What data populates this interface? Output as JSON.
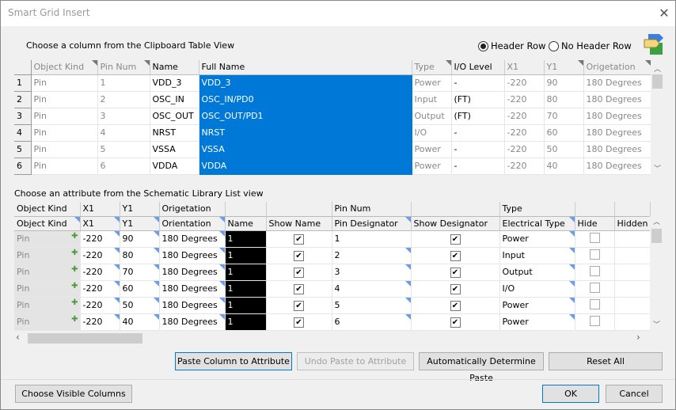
{
  "window": {
    "title": "Smart Grid Insert",
    "close_label": "✕"
  },
  "clipboard": {
    "label": "Choose a column from the Clipboard Table View",
    "header_row_label": "Header Row",
    "no_header_row_label": "No Header Row",
    "header_row_selected": true,
    "columns": [
      "Object Kind",
      "Pin Num",
      "Name",
      "Full Name",
      "Type",
      "I/O Level",
      "X1",
      "Y1",
      "Origetation"
    ],
    "selected_column": "Full Name",
    "rows": [
      [
        "1",
        "Pin",
        "1",
        "VDD_3",
        "VDD_3",
        "Power",
        "-",
        "-220",
        "90",
        "180 Degrees"
      ],
      [
        "2",
        "Pin",
        "2",
        "OSC_IN",
        "OSC_IN/PD0",
        "Input",
        "(FT)",
        "-220",
        "80",
        "180 Degrees"
      ],
      [
        "3",
        "Pin",
        "3",
        "OSC_OUT",
        "OSC_OUT/PD1",
        "Output",
        "(FT)",
        "-220",
        "70",
        "180 Degrees"
      ],
      [
        "4",
        "Pin",
        "4",
        "NRST",
        "NRST",
        "I/O",
        "-",
        "-220",
        "60",
        "180 Degrees"
      ],
      [
        "5",
        "Pin",
        "5",
        "VSSA",
        "VSSA",
        "Power",
        "-",
        "-220",
        "50",
        "180 Degrees"
      ],
      [
        "6",
        "Pin",
        "6",
        "VDDA",
        "VDDA",
        "Power",
        "-",
        "-220",
        "40",
        "180 Degrees"
      ]
    ]
  },
  "schematic": {
    "label": "Choose an attribute from the Schematic Library List view",
    "mapped_headers": [
      "Object Kind",
      "X1",
      "Y1",
      "Origetation",
      "",
      "",
      "Pin Num",
      "",
      "Type",
      "",
      ""
    ],
    "columns": [
      "Object Kind",
      "X1",
      "Y1",
      "Orientation",
      "Name",
      "Show Name",
      "Pin Designator",
      "Show Designator",
      "Electrical Type",
      "Hide",
      "Hidden"
    ],
    "rows": [
      {
        "kind": "Pin",
        "x1": "-220",
        "y1": "90",
        "orientation": "180 Degrees",
        "name": "1",
        "show_name": true,
        "designator": "1",
        "show_designator": true,
        "type": "Power",
        "hide": false
      },
      {
        "kind": "Pin",
        "x1": "-220",
        "y1": "80",
        "orientation": "180 Degrees",
        "name": "1",
        "show_name": true,
        "designator": "2",
        "show_designator": true,
        "type": "Input",
        "hide": false
      },
      {
        "kind": "Pin",
        "x1": "-220",
        "y1": "70",
        "orientation": "180 Degrees",
        "name": "1",
        "show_name": true,
        "designator": "3",
        "show_designator": true,
        "type": "Output",
        "hide": false
      },
      {
        "kind": "Pin",
        "x1": "-220",
        "y1": "60",
        "orientation": "180 Degrees",
        "name": "1",
        "show_name": true,
        "designator": "4",
        "show_designator": true,
        "type": "I/O",
        "hide": false
      },
      {
        "kind": "Pin",
        "x1": "-220",
        "y1": "50",
        "orientation": "180 Degrees",
        "name": "1",
        "show_name": true,
        "designator": "5",
        "show_designator": true,
        "type": "Power",
        "hide": false
      },
      {
        "kind": "Pin",
        "x1": "-220",
        "y1": "40",
        "orientation": "180 Degrees",
        "name": "1",
        "show_name": true,
        "designator": "6",
        "show_designator": true,
        "type": "Power",
        "hide": false
      }
    ]
  },
  "buttons": {
    "paste": "Paste Column to Attribute",
    "undo": "Undo Paste to Attribute",
    "auto": "Automatically Determine Paste",
    "reset": "Reset All",
    "visible_columns": "Choose Visible Columns",
    "ok": "OK",
    "cancel": "Cancel"
  },
  "colors": {
    "selection": "#0078d7",
    "focus_border": "#0078d7"
  }
}
